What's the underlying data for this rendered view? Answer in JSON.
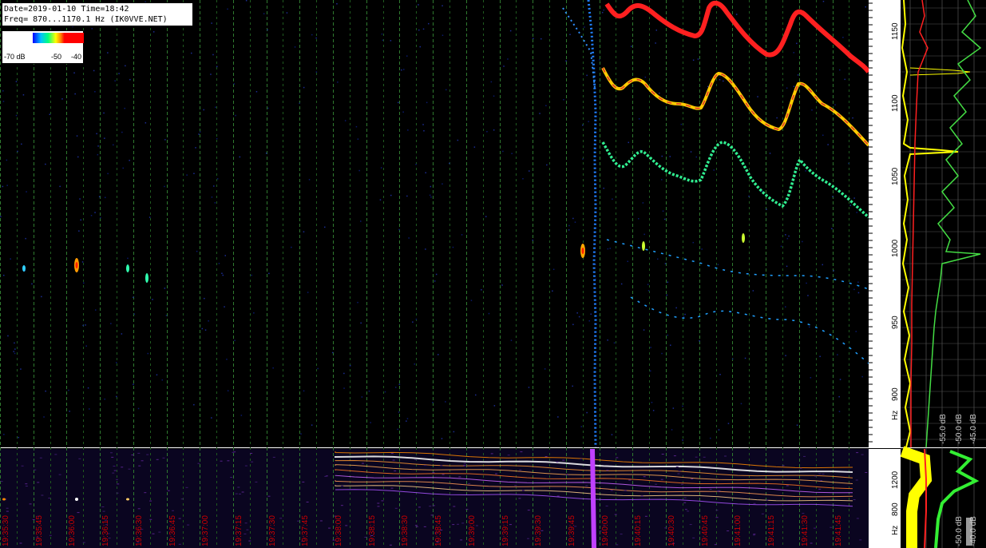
{
  "header": {
    "line1": "Date=2019-01-10 Time=18:42",
    "line2": "Freq= 870...1170.1 Hz (IK0VVE.NET)"
  },
  "scale": {
    "labels": [
      "-70 dB",
      "-50",
      "-40"
    ]
  },
  "right_axis": {
    "freq_labels": [
      "1150",
      "1100",
      "1050",
      "1000",
      "950",
      "900",
      "Hz"
    ],
    "db_labels": [
      "-45.0 dB",
      "-50.0 dB",
      "-55.0 dB"
    ],
    "lower_freq_labels": [
      "1200",
      "800",
      "Hz"
    ],
    "lower_db_labels": [
      "-40.0 dB",
      "-50.0 dB"
    ]
  },
  "time_axis": {
    "labels": [
      "19:35:30",
      "19:35:45",
      "19:36:00",
      "19:36:15",
      "19:36:30",
      "19:36:45",
      "19:37:00",
      "19:37:15",
      "19:37:30",
      "19:37:45",
      "19:38:00",
      "19:38:15",
      "19:38:30",
      "19:38:45",
      "19:39:00",
      "19:39:15",
      "19:39:30",
      "19:39:45",
      "19:40:00",
      "19:40:15",
      "19:40:30",
      "19:40:45",
      "19:41:00",
      "19:41:15",
      "19:41:30",
      "19:41:45"
    ]
  },
  "colors": {
    "background": "#000000",
    "gridline": "#2f7a2f",
    "time_label": "#cc0000",
    "signal_strong": "#ff2020",
    "trace_yellow": "#ffff00",
    "trace_green": "#33cc33"
  }
}
